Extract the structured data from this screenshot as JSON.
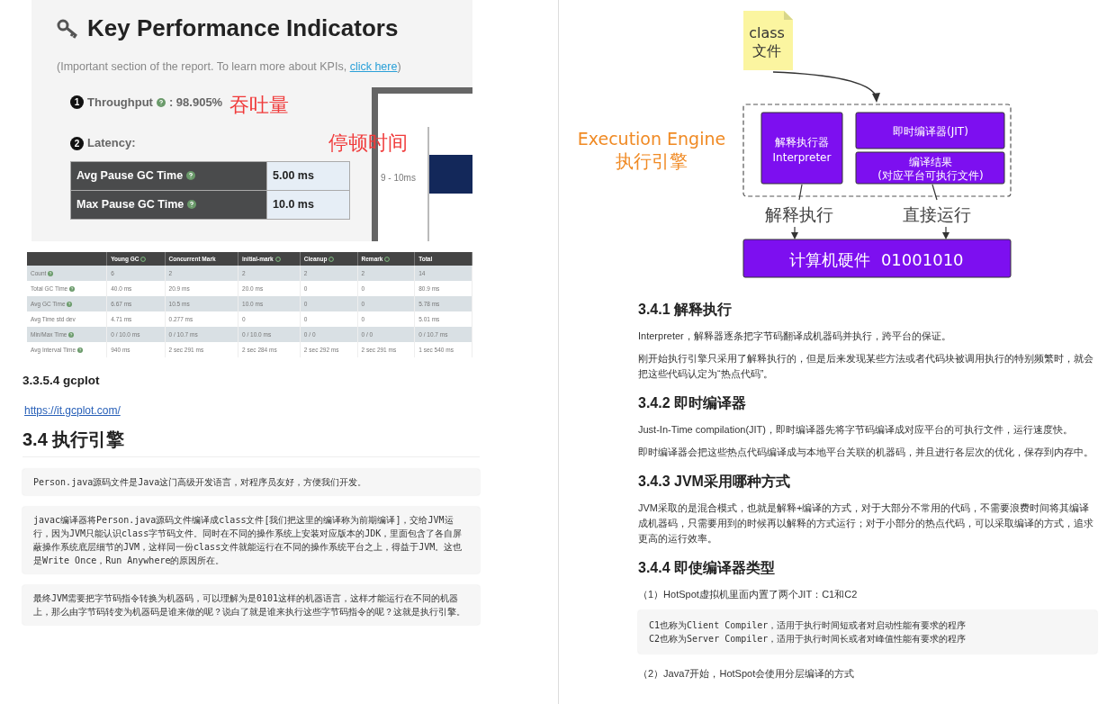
{
  "left_page": {
    "kpi_report": {
      "title": "Key Performance Indicators",
      "subtitle_before": "(Important section of the report. To learn more about KPIs, ",
      "subtitle_link": "click here",
      "subtitle_after": ")",
      "throughput": {
        "number": "1",
        "label": "Throughput",
        "value": ": 98.905%",
        "help": true,
        "annotation": "吞吐量"
      },
      "latency": {
        "number": "2",
        "label": "Latency:",
        "annotation": "停顿时间",
        "rows": [
          {
            "label": "Avg Pause GC Time",
            "help": true,
            "value": "5.00 ms"
          },
          {
            "label": "Max Pause GC Time",
            "help": true,
            "value": "10.0 ms"
          }
        ]
      },
      "chart_fragment": {
        "axis_label": "9 - 10ms"
      }
    },
    "gc_table": {
      "columns": [
        {
          "help": false
        },
        {
          "label": "Young GC",
          "help": true
        },
        {
          "label": "Concurrent Mark",
          "help": false
        },
        {
          "label": "initial-mark",
          "help": true
        },
        {
          "label": "Cleanup",
          "help": true
        },
        {
          "label": "Remark",
          "help": true
        },
        {
          "label": "Total",
          "help": false
        }
      ],
      "rows": [
        {
          "help": true,
          "cells": [
            "Count",
            "6",
            "2",
            "2",
            "2",
            "2",
            "14"
          ]
        },
        {
          "help": true,
          "cells": [
            "Total GC Time",
            "40.0 ms",
            "20.9 ms",
            "20.0 ms",
            "0",
            "0",
            "80.9 ms"
          ]
        },
        {
          "help": true,
          "cells": [
            "Avg GC Time",
            "6.67 ms",
            "10.5 ms",
            "10.0 ms",
            "0",
            "0",
            "5.78 ms"
          ]
        },
        {
          "help": false,
          "cells": [
            "Avg Time std dev",
            "4.71 ms",
            "0.277 ms",
            "0",
            "0",
            "0",
            "5.01 ms"
          ]
        },
        {
          "help": true,
          "cells": [
            "Min/Max Time",
            "0 / 10.0 ms",
            "0 / 10.7 ms",
            "0 / 10.0 ms",
            "0 / 0",
            "0 / 0",
            "0 / 10.7 ms"
          ]
        },
        {
          "help": true,
          "cells": [
            "Avg Interval Time",
            "940 ms",
            "2 sec 291 ms",
            "2 sec 284 ms",
            "2 sec 292 ms",
            "2 sec 291 ms",
            "1 sec 540 ms"
          ]
        }
      ]
    },
    "sections": [
      {
        "kind": "h4",
        "text": "3.3.5.4 gcplot"
      },
      {
        "kind": "link",
        "text": "https://it.gcplot.com/"
      },
      {
        "kind": "h2",
        "text": "3.4 执行引擎"
      },
      {
        "kind": "code",
        "lines": [
          "Person.java源码文件是Java这门高级开发语言，对程序员友好，方便我们开发。"
        ]
      },
      {
        "kind": "code",
        "lines": [
          "javac编译器将Person.java源码文件编译成class文件[我们把这里的编译称为前期编译]，交给JVM运行，因为JVM只能认识class字节码文件。同时在不同的操作系统上安装对应版本的JDK，里面包含了各自屏蔽操作系统底层细节的JVM，这样同一份class文件就能运行在不同的操作系统平台之上，得益于JVM。这也是Write Once，Run Anywhere的原因所在。"
        ]
      },
      {
        "kind": "code",
        "lines": [
          "最终JVM需要把字节码指令转换为机器码，可以理解为是0101这样的机器语言，这样才能运行在不同的机器上，那么由字节码转变为机器码是谁来做的呢？说白了就是谁来执行这些字节码指令的呢？这就是执行引擎。"
        ]
      }
    ]
  },
  "right_page": {
    "diagram": {
      "note": [
        "class",
        "文件"
      ],
      "engine_label": [
        "Execution Engine",
        "执行引擎"
      ],
      "interpreter": [
        "解释执行器",
        "Interpreter"
      ],
      "jit": "即时编译器(JIT)",
      "jit_result": [
        "编译结果",
        "(对应平台可执行文件)"
      ],
      "paths": [
        "解释执行",
        "直接运行"
      ],
      "hardware": "计算机硬件  01001010"
    },
    "sections": [
      {
        "kind": "h3",
        "text": "3.4.1 解释执行"
      },
      {
        "kind": "p",
        "text": "Interpreter，解释器逐条把字节码翻译成机器码并执行，跨平台的保证。"
      },
      {
        "kind": "p",
        "text": "刚开始执行引擎只采用了解释执行的，但是后来发现某些方法或者代码块被调用执行的特别频繁时，就会把这些代码认定为“热点代码”。"
      },
      {
        "kind": "h3",
        "text": "3.4.2 即时编译器"
      },
      {
        "kind": "p",
        "text": "Just-In-Time compilation(JIT)，即时编译器先将字节码编译成对应平台的可执行文件，运行速度快。"
      },
      {
        "kind": "p",
        "text": "即时编译器会把这些热点代码编译成与本地平台关联的机器码，并且进行各层次的优化，保存到内存中。"
      },
      {
        "kind": "h3",
        "text": "3.4.3 JVM采用哪种方式"
      },
      {
        "kind": "p",
        "text": "JVM采取的是混合模式，也就是解释+编译的方式，对于大部分不常用的代码，不需要浪费时间将其编译成机器码，只需要用到的时候再以解释的方式运行；对于小部分的热点代码，可以采取编译的方式，追求更高的运行效率。"
      },
      {
        "kind": "h3",
        "text": "3.4.4 即使编译器类型"
      },
      {
        "kind": "p",
        "text": "（1）HotSpot虚拟机里面内置了两个JIT：C1和C2"
      },
      {
        "kind": "code",
        "lines": [
          "C1也称为Client Compiler，适用于执行时间短或者对启动性能有要求的程序",
          "C2也称为Server Compiler，适用于执行时间长或者对峰值性能有要求的程序"
        ]
      },
      {
        "kind": "p",
        "text": "（2）Java7开始，HotSpot会使用分层编译的方式"
      }
    ]
  }
}
